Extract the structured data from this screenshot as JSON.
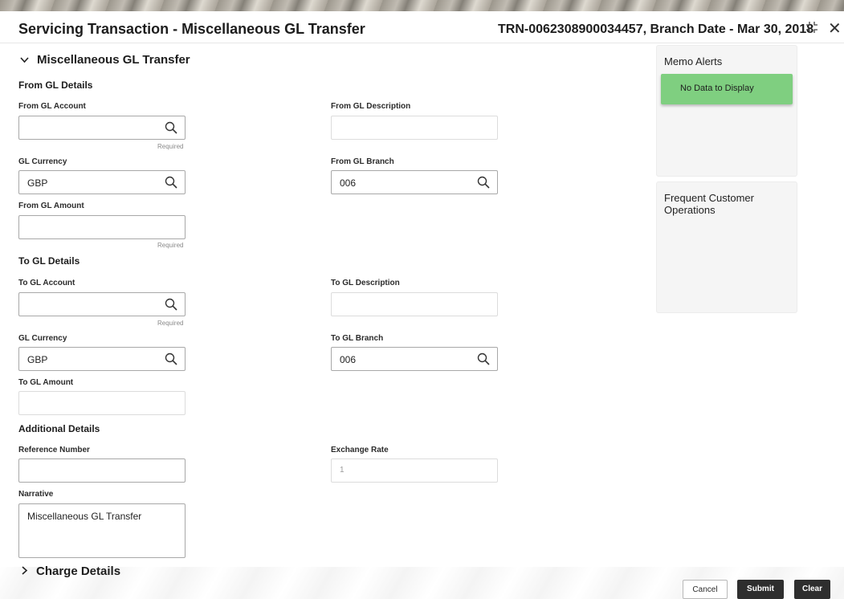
{
  "header": {
    "title": "Servicing Transaction - Miscellaneous GL Transfer",
    "subtitle": "TRN-0062308900034457, Branch Date - Mar 30, 2018"
  },
  "section": {
    "title": "Miscellaneous GL Transfer",
    "charge_title": "Charge Details"
  },
  "from_gl": {
    "heading": "From GL Details",
    "account_label": "From GL Account",
    "account_value": "",
    "account_required": "Required",
    "description_label": "From GL Description",
    "description_value": "",
    "currency_label": "GL Currency",
    "currency_value": "GBP",
    "branch_label": "From GL Branch",
    "branch_value": "006",
    "amount_label": "From GL Amount",
    "amount_value": "",
    "amount_required": "Required"
  },
  "to_gl": {
    "heading": "To GL Details",
    "account_label": "To GL Account",
    "account_value": "",
    "account_required": "Required",
    "description_label": "To GL Description",
    "description_value": "",
    "currency_label": "GL Currency",
    "currency_value": "GBP",
    "branch_label": "To GL Branch",
    "branch_value": "006",
    "amount_label": "To GL Amount",
    "amount_value": ""
  },
  "additional": {
    "heading": "Additional Details",
    "reference_label": "Reference Number",
    "reference_value": "",
    "exchange_label": "Exchange Rate",
    "exchange_value": "1",
    "narrative_label": "Narrative",
    "narrative_value": "Miscellaneous GL Transfer"
  },
  "side": {
    "memo_title": "Memo Alerts",
    "memo_empty": "No Data to Display",
    "frequent_title": "Frequent Customer Operations"
  },
  "actions": {
    "cancel": "Cancel",
    "submit": "Submit",
    "clear": "Clear"
  },
  "icons": {
    "collapse": "chevron-down-icon",
    "expand": "chevron-right-icon",
    "search": "search-icon",
    "maximize": "expand-icon",
    "close": "close-icon"
  }
}
